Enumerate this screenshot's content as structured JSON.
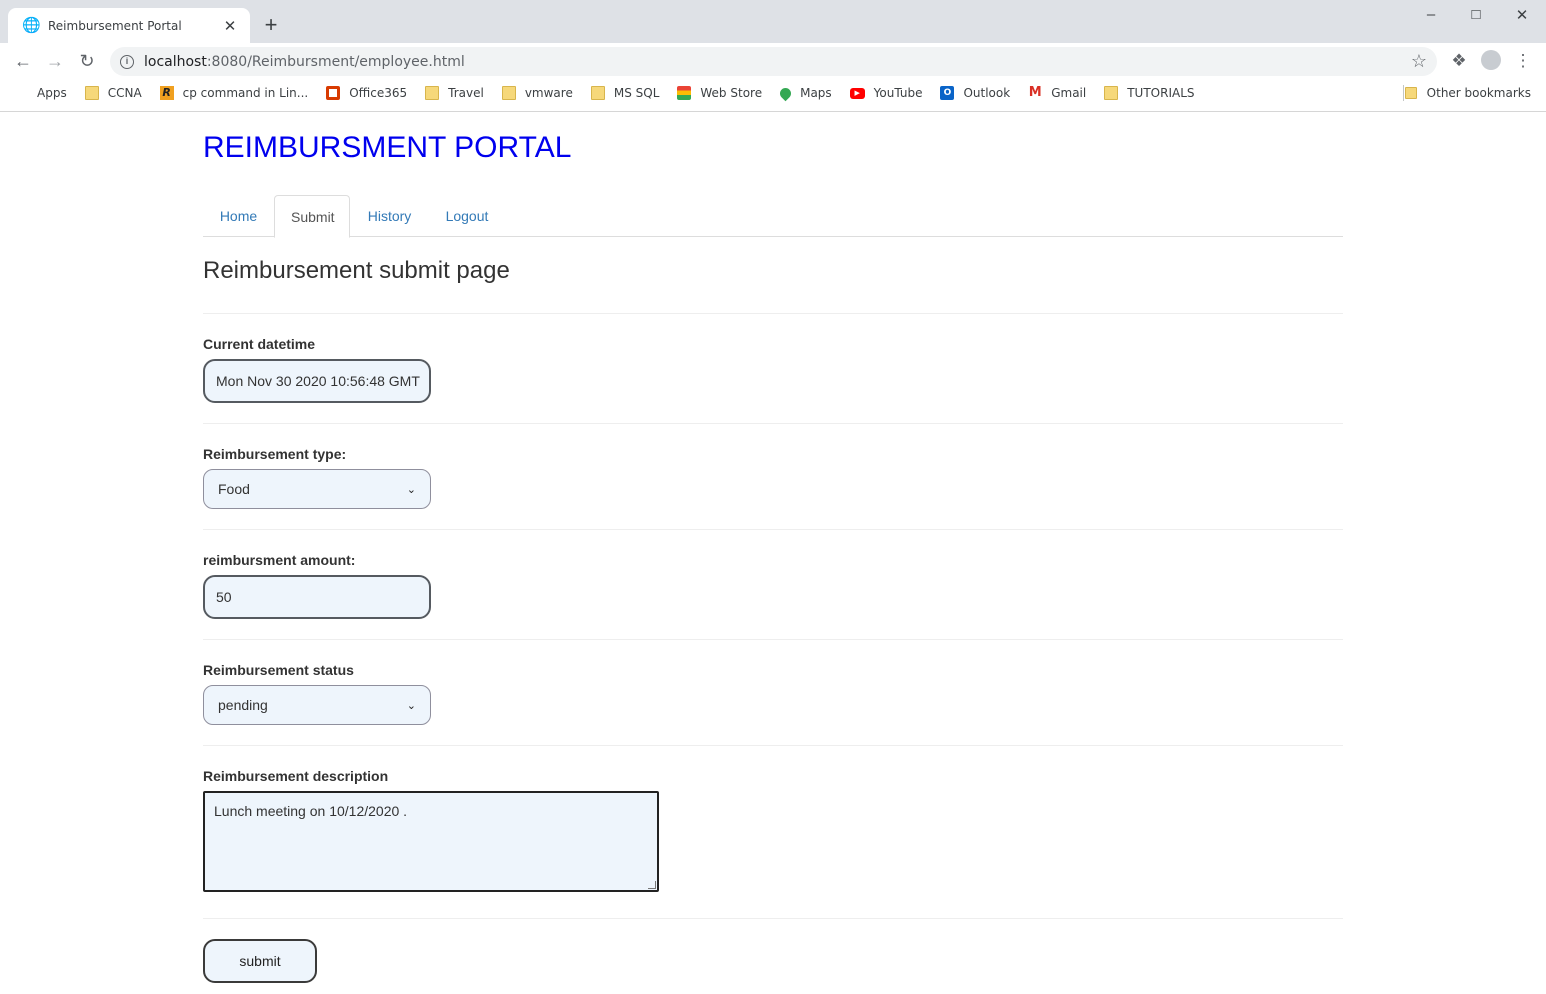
{
  "browser": {
    "tab_title": "Reimbursement Portal",
    "url_host": "localhost",
    "url_rest": ":8080/Reimbursment/employee.html",
    "bookmarks": [
      "Apps",
      "CCNA",
      "cp command in Lin...",
      "Office365",
      "Travel",
      "vmware",
      "MS SQL",
      "Web Store",
      "Maps",
      "YouTube",
      "Outlook",
      "Gmail",
      "TUTORIALS"
    ],
    "other_bookmarks": "Other bookmarks"
  },
  "page": {
    "title": "REIMBURSMENT PORTAL",
    "nav": [
      "Home",
      "Submit",
      "History",
      "Logout"
    ],
    "active_tab": "Submit",
    "heading": "Reimbursement submit page"
  },
  "form": {
    "datetime_label": "Current datetime",
    "datetime_value": "Mon Nov 30 2020 10:56:48 GMT",
    "type_label": "Reimbursement type:",
    "type_value": "Food",
    "amount_label": "reimbursment amount:",
    "amount_value": "50",
    "status_label": "Reimbursement status",
    "status_value": "pending",
    "description_label": "Reimbursement description",
    "description_value": "Lunch meeting on 10/12/2020 .",
    "submit_label": "submit"
  }
}
